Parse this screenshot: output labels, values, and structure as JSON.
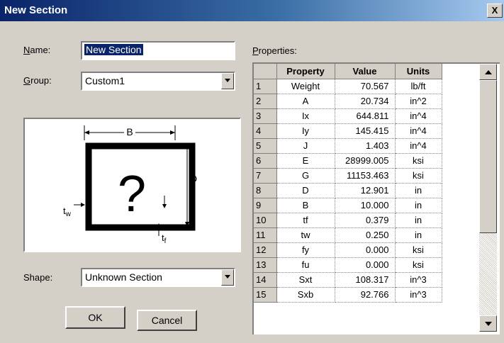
{
  "window": {
    "title": "New Section",
    "close_glyph": "X"
  },
  "name_field": {
    "label": "Name:",
    "value": "New Section"
  },
  "group_field": {
    "label": "Group:",
    "value": "Custom1"
  },
  "shape_field": {
    "label": "Shape:",
    "value": "Unknown Section"
  },
  "preview": {
    "dim_b": "B",
    "dim_d": "D",
    "question_mark": "?",
    "tw_main": "t",
    "tw_sub": "w",
    "tf_main": "t",
    "tf_sub": "f"
  },
  "buttons": {
    "ok": "OK",
    "cancel": "Cancel"
  },
  "properties": {
    "label": "Properties:",
    "headers": {
      "property": "Property",
      "value": "Value",
      "units": "Units"
    },
    "rows": [
      {
        "num": "1",
        "property": "Weight",
        "value": "70.567",
        "units": "lb/ft"
      },
      {
        "num": "2",
        "property": "A",
        "value": "20.734",
        "units": "in^2"
      },
      {
        "num": "3",
        "property": "Ix",
        "value": "644.811",
        "units": "in^4"
      },
      {
        "num": "4",
        "property": "Iy",
        "value": "145.415",
        "units": "in^4"
      },
      {
        "num": "5",
        "property": "J",
        "value": "1.403",
        "units": "in^4"
      },
      {
        "num": "6",
        "property": "E",
        "value": "28999.005",
        "units": "ksi"
      },
      {
        "num": "7",
        "property": "G",
        "value": "11153.463",
        "units": "ksi"
      },
      {
        "num": "8",
        "property": "D",
        "value": "12.901",
        "units": "in"
      },
      {
        "num": "9",
        "property": "B",
        "value": "10.000",
        "units": "in"
      },
      {
        "num": "10",
        "property": "tf",
        "value": "0.379",
        "units": "in"
      },
      {
        "num": "11",
        "property": "tw",
        "value": "0.250",
        "units": "in"
      },
      {
        "num": "12",
        "property": "fy",
        "value": "0.000",
        "units": "ksi"
      },
      {
        "num": "13",
        "property": "fu",
        "value": "0.000",
        "units": "ksi"
      },
      {
        "num": "14",
        "property": "Sxt",
        "value": "108.317",
        "units": "in^3"
      },
      {
        "num": "15",
        "property": "Sxb",
        "value": "92.766",
        "units": "in^3"
      }
    ]
  },
  "colors": {
    "title_active": "#0a246a",
    "face": "#d4d0c8",
    "selection": "#0a246a"
  }
}
